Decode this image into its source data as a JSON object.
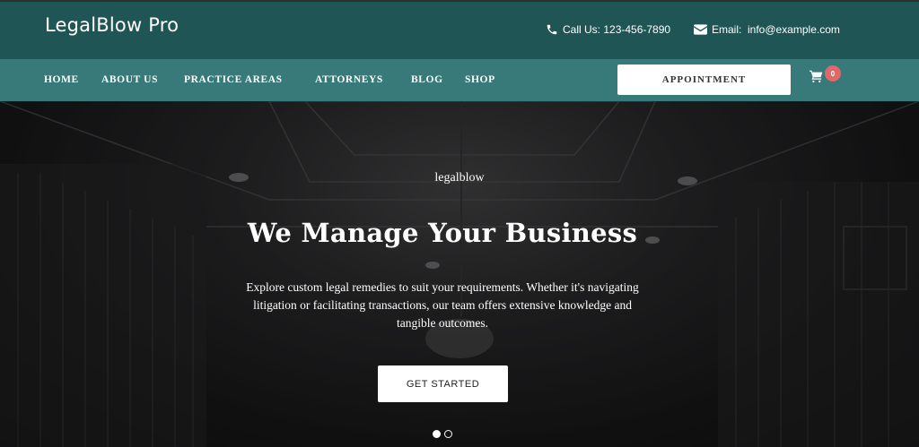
{
  "brand": {
    "name": "LegalBlow Pro"
  },
  "contact": {
    "phone_label": "Call Us: 123-456-7890",
    "email_label": "Email:  info@example.com"
  },
  "nav": {
    "items": [
      {
        "label": "HOME"
      },
      {
        "label": "ABOUT US"
      },
      {
        "label": "PRACTICE AREAS"
      },
      {
        "label": "ATTORNEYS"
      },
      {
        "label": "BLOG"
      },
      {
        "label": "SHOP"
      }
    ],
    "appointment_label": "APPOINTMENT",
    "cart_count": "0"
  },
  "hero": {
    "subtitle": "legalblow",
    "title": "We Manage Your Business",
    "description": "Explore custom legal remedies to suit your requirements. Whether it's navigating litigation or facilitating transactions, our team offers extensive knowledge and tangible outcomes.",
    "cta_label": "GET STARTED",
    "slides_total": 2,
    "active_slide": 1
  },
  "colors": {
    "topbar": "#1f5655",
    "navbar": "#377a79",
    "badge": "#e0686a"
  },
  "icons": [
    "phone-icon",
    "envelope-icon",
    "cart-icon"
  ]
}
